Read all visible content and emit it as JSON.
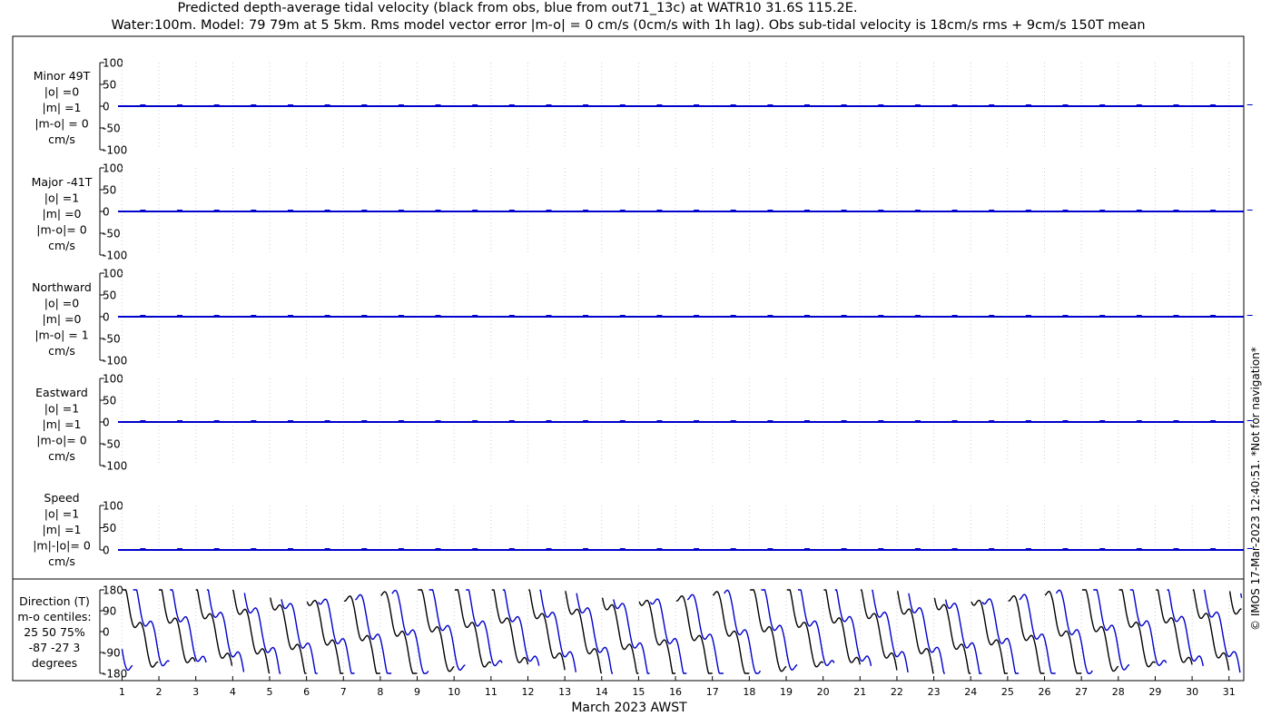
{
  "title": {
    "line1": "Predicted depth-average tidal velocity (black from obs, blue from out71_13c) at WATR10 31.6S 115.2E.",
    "line2": "Water:100m. Model: 79 79m at 5 5km. Rms model vector error |m-o| = 0 cm/s (0cm/s with 1h lag). Obs sub-tidal velocity is 18cm/s rms + 9cm/s 150T mean"
  },
  "side_note": "© IMOS 17-Mar-2023 12:40:51. *Not for navigation*",
  "colors": {
    "obs": "#000000",
    "model": "#0000cc",
    "axis": "#000000"
  },
  "chart_data": [
    {
      "type": "line",
      "panel": "minor",
      "label_lines": [
        "Minor 49T",
        "|o| =0",
        "|m| =1",
        "|m-o| = 0",
        "cm/s"
      ],
      "ylim": [
        -100,
        100
      ],
      "yticks": [
        100,
        50,
        0,
        -50,
        -100
      ],
      "x": [
        1,
        31
      ],
      "series": [
        {
          "name": "obs",
          "values": [
            0,
            0
          ]
        },
        {
          "name": "model",
          "values": [
            0,
            0
          ]
        }
      ]
    },
    {
      "type": "line",
      "panel": "major",
      "label_lines": [
        "Major -41T",
        "|o| =1",
        "|m| =0",
        "|m-o|= 0",
        "cm/s"
      ],
      "ylim": [
        -100,
        100
      ],
      "yticks": [
        100,
        50,
        0,
        -50,
        -100
      ],
      "x": [
        1,
        31
      ],
      "series": [
        {
          "name": "obs",
          "values": [
            0,
            0
          ]
        },
        {
          "name": "model",
          "values": [
            0,
            0
          ]
        }
      ]
    },
    {
      "type": "line",
      "panel": "northward",
      "label_lines": [
        "Northward",
        "|o| =0",
        "|m| =0",
        "|m-o| = 1",
        "cm/s"
      ],
      "ylim": [
        -100,
        100
      ],
      "yticks": [
        100,
        50,
        0,
        -50,
        -100
      ],
      "x": [
        1,
        31
      ],
      "series": [
        {
          "name": "obs",
          "values": [
            0,
            0
          ]
        },
        {
          "name": "model",
          "values": [
            0,
            0
          ]
        }
      ]
    },
    {
      "type": "line",
      "panel": "eastward",
      "label_lines": [
        "Eastward",
        "|o| =1",
        "|m| =1",
        "|m-o|= 0",
        "cm/s"
      ],
      "ylim": [
        -100,
        100
      ],
      "yticks": [
        100,
        50,
        0,
        -50,
        -100
      ],
      "x": [
        1,
        31
      ],
      "series": [
        {
          "name": "obs",
          "values": [
            0,
            0
          ]
        },
        {
          "name": "model",
          "values": [
            0,
            0
          ]
        }
      ]
    },
    {
      "type": "line",
      "panel": "speed",
      "label_lines": [
        "Speed",
        "|o| =1",
        "|m| =1",
        "|m|-|o|= 0",
        "cm/s"
      ],
      "ylim": [
        0,
        100
      ],
      "yticks": [
        100,
        50,
        0
      ],
      "x": [
        1,
        31
      ],
      "series": [
        {
          "name": "obs",
          "values": [
            0,
            0
          ]
        },
        {
          "name": "model",
          "values": [
            0,
            0
          ]
        }
      ]
    },
    {
      "type": "line",
      "panel": "direction",
      "label_lines": [
        "Direction (T)",
        "m-o centiles:",
        "25  50  75%",
        "-87 -27   3",
        "degrees"
      ],
      "ylim": [
        -180,
        180
      ],
      "yticks": [
        180,
        90,
        0,
        -90,
        -180
      ],
      "x_range": [
        0.4,
        31.4
      ],
      "series": [
        {
          "name": "obs",
          "period_days": 1.0,
          "phase_days": 0.0,
          "amplitude": 180
        },
        {
          "name": "model",
          "period_days": 1.0,
          "phase_days": 0.3,
          "amplitude": 180
        }
      ]
    }
  ],
  "xaxis": {
    "label": "March 2023 AWST",
    "ticks": [
      "1",
      "2",
      "3",
      "4",
      "5",
      "6",
      "7",
      "8",
      "9",
      "10",
      "11",
      "12",
      "13",
      "14",
      "15",
      "16",
      "17",
      "18",
      "19",
      "20",
      "21",
      "22",
      "23",
      "24",
      "25",
      "26",
      "27",
      "28",
      "29",
      "30",
      "31"
    ],
    "range": [
      0.4,
      31.4
    ]
  }
}
